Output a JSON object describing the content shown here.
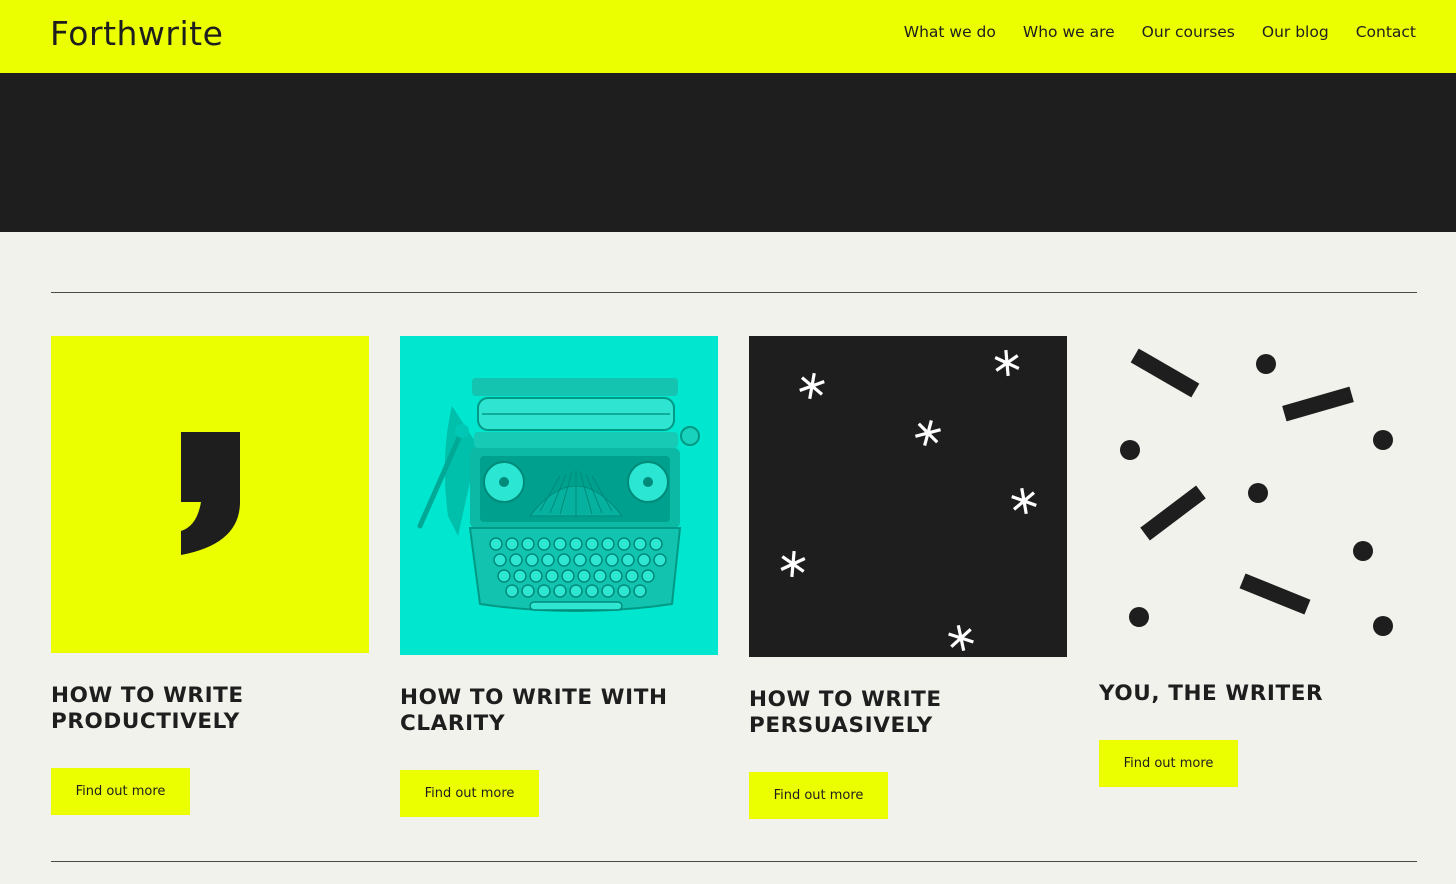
{
  "header": {
    "logo": "Forthwrite",
    "nav": [
      {
        "label": "What we do"
      },
      {
        "label": "Who we are"
      },
      {
        "label": "Our courses"
      },
      {
        "label": "Our blog"
      },
      {
        "label": "Contact"
      }
    ]
  },
  "colors": {
    "accent": "#ebff00",
    "dark": "#1e1e1e",
    "background": "#f2f2ec",
    "teal": "#00e5cc"
  },
  "cards": [
    {
      "title": "How to write productively",
      "button": "Find out more",
      "image": "comma-icon"
    },
    {
      "title": "How to write with clarity",
      "button": "Find out more",
      "image": "typewriter-photo"
    },
    {
      "title": "How to write persuasively",
      "button": "Find out more",
      "image": "asterisks-pattern"
    },
    {
      "title": "You, the writer",
      "button": "Find out more",
      "image": "confetti-pattern"
    }
  ]
}
